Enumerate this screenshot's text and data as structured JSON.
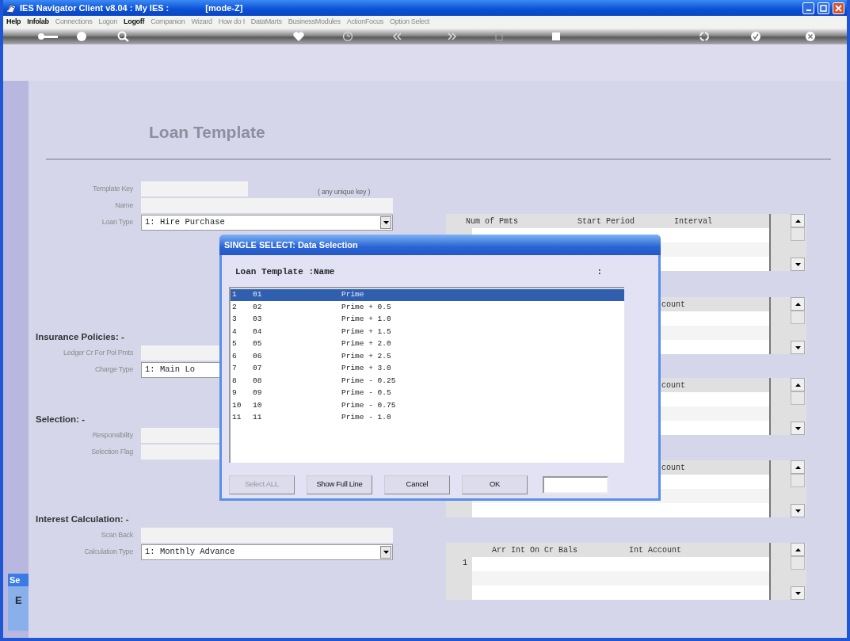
{
  "window": {
    "title": "IES Navigator Client v8.04 : My IES :",
    "mode": "[mode-Z]"
  },
  "menu": [
    {
      "label": "Help",
      "disabled": false
    },
    {
      "label": "Infolab",
      "disabled": false
    },
    {
      "label": "Connections",
      "disabled": true
    },
    {
      "label": "Logon",
      "disabled": true
    },
    {
      "label": "Logoff",
      "disabled": false
    },
    {
      "label": "Companion",
      "disabled": true
    },
    {
      "label": "Wizard",
      "disabled": true
    },
    {
      "label": "How do I",
      "disabled": true
    },
    {
      "label": "DataMarts",
      "disabled": true
    },
    {
      "label": "BusinessModules",
      "disabled": true
    },
    {
      "label": "ActionFocus",
      "disabled": true
    },
    {
      "label": "Option Select",
      "disabled": true
    }
  ],
  "page_title": "Loan Template",
  "groups": [
    {
      "fields": [
        {
          "label": "Template Key",
          "kind": "short_text",
          "note": "( any unique key )"
        },
        {
          "label": "Name",
          "kind": "text"
        },
        {
          "label": "Loan Type",
          "kind": "select",
          "value": "1: Hire Purchase"
        }
      ]
    },
    {
      "heading": "Insurance Policies: -",
      "fields": [
        {
          "label": "Ledger Cr For Pol Pmts",
          "kind": "text"
        },
        {
          "label": "Charge Type",
          "kind": "select",
          "value": "1: Main Lo"
        }
      ]
    },
    {
      "heading": "Selection: -",
      "fields": [
        {
          "label": "Responsibility",
          "kind": "text"
        },
        {
          "label": "Selection Flag",
          "kind": "text"
        }
      ]
    },
    {
      "heading": "Interest Calculation: -",
      "fields": [
        {
          "label": "Scan Back",
          "kind": "text"
        },
        {
          "label": "Calculation Type",
          "kind": "select",
          "value": "1: Monthly Advance"
        }
      ]
    }
  ],
  "grids": [
    {
      "columns": [
        "Num of Pmts",
        "Start Period",
        "Interval"
      ]
    },
    {
      "columns": [
        "count"
      ]
    },
    {
      "columns": [
        "count"
      ]
    },
    {
      "columns": [
        "count"
      ]
    },
    {
      "columns": [
        "Arr Int On Cr Bals",
        "Int Account"
      ],
      "row_labels": [
        "1"
      ]
    }
  ],
  "side_tab": {
    "title": "Se",
    "letter": "E"
  },
  "dialog": {
    "title": "SINGLE SELECT: Data Selection",
    "heading": "Loan Template :Name",
    "heading_mark": ":",
    "items": [
      {
        "num": "1",
        "code": "01",
        "name": "Prime",
        "selected": true
      },
      {
        "num": "2",
        "code": "02",
        "name": "Prime + 0.5",
        "selected": false
      },
      {
        "num": "3",
        "code": "03",
        "name": "Prime + 1.0",
        "selected": false
      },
      {
        "num": "4",
        "code": "04",
        "name": "Prime + 1.5",
        "selected": false
      },
      {
        "num": "5",
        "code": "05",
        "name": "Prime + 2.0",
        "selected": false
      },
      {
        "num": "6",
        "code": "06",
        "name": "Prime + 2.5",
        "selected": false
      },
      {
        "num": "7",
        "code": "07",
        "name": "Prime + 3.0",
        "selected": false
      },
      {
        "num": "8",
        "code": "08",
        "name": "Prime - 0.25",
        "selected": false
      },
      {
        "num": "9",
        "code": "09",
        "name": "Prime - 0.5",
        "selected": false
      },
      {
        "num": "10",
        "code": "10",
        "name": "Prime - 0.75",
        "selected": false
      },
      {
        "num": "11",
        "code": "11",
        "name": "Prime - 1.0",
        "selected": false
      }
    ],
    "buttons": [
      {
        "label": "Select ALL",
        "disabled": true
      },
      {
        "label": "Show Full Line",
        "disabled": false
      },
      {
        "label": "Cancel",
        "disabled": false
      },
      {
        "label": "OK",
        "disabled": false
      }
    ]
  }
}
